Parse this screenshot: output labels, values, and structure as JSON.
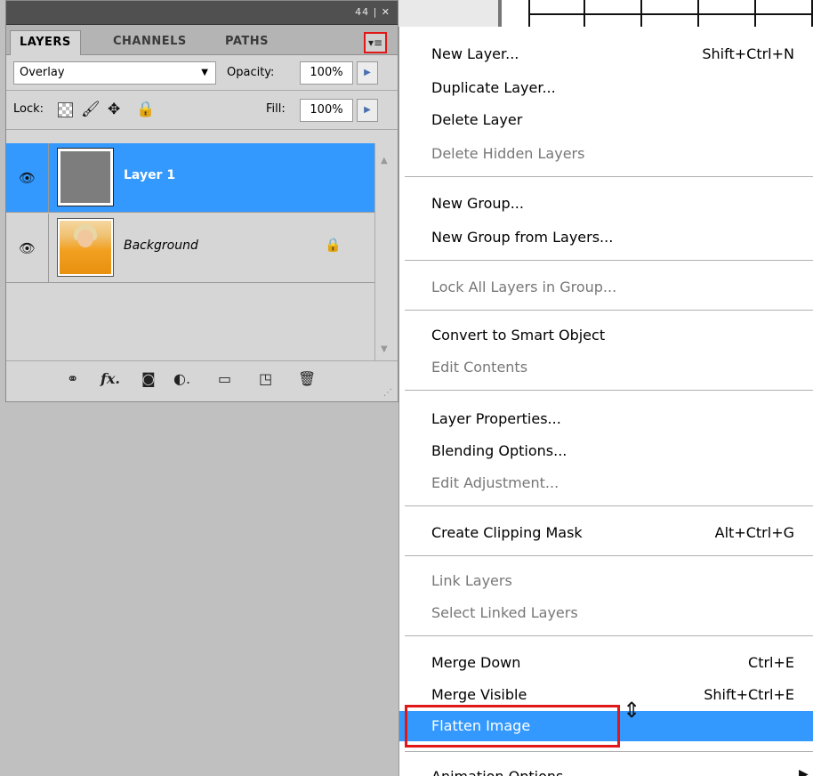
{
  "panel": {
    "titlebar_controls": "44 | ✕",
    "tabs": [
      "LAYERS",
      "CHANNELS",
      "PATHS"
    ],
    "menu_button_icon": "panel-menu-icon",
    "blend_mode": "Overlay",
    "opacity_label": "Opacity:",
    "opacity_value": "100%",
    "lock_label": "Lock:",
    "fill_label": "Fill:",
    "fill_value": "100%",
    "layers": [
      {
        "name": "Layer 1",
        "selected": true
      },
      {
        "name": "Background",
        "selected": false,
        "locked": true
      }
    ],
    "footer_icons": [
      "link-icon",
      "fx-icon",
      "mask-icon",
      "adjustment-icon",
      "folder-icon",
      "new-layer-icon",
      "trash-icon"
    ]
  },
  "menu": {
    "items": [
      {
        "label": "New Layer...",
        "shortcut": "Shift+Ctrl+N",
        "enabled": true
      },
      {
        "label": "Duplicate Layer...",
        "shortcut": "",
        "enabled": true
      },
      {
        "label": "Delete Layer",
        "shortcut": "",
        "enabled": true
      },
      {
        "label": "Delete Hidden Layers",
        "shortcut": "",
        "enabled": false
      },
      {
        "label": "New Group...",
        "shortcut": "",
        "enabled": true
      },
      {
        "label": "New Group from Layers...",
        "shortcut": "",
        "enabled": true
      },
      {
        "label": "Lock All Layers in Group...",
        "shortcut": "",
        "enabled": false
      },
      {
        "label": "Convert to Smart Object",
        "shortcut": "",
        "enabled": true
      },
      {
        "label": "Edit Contents",
        "shortcut": "",
        "enabled": false
      },
      {
        "label": "Layer Properties...",
        "shortcut": "",
        "enabled": true
      },
      {
        "label": "Blending Options...",
        "shortcut": "",
        "enabled": true
      },
      {
        "label": "Edit Adjustment...",
        "shortcut": "",
        "enabled": false
      },
      {
        "label": "Create Clipping Mask",
        "shortcut": "Alt+Ctrl+G",
        "enabled": true
      },
      {
        "label": "Link Layers",
        "shortcut": "",
        "enabled": false
      },
      {
        "label": "Select Linked Layers",
        "shortcut": "",
        "enabled": false
      },
      {
        "label": "Merge Down",
        "shortcut": "Ctrl+E",
        "enabled": true
      },
      {
        "label": "Merge Visible",
        "shortcut": "Shift+Ctrl+E",
        "enabled": true
      },
      {
        "label": "Flatten Image",
        "shortcut": "",
        "enabled": true,
        "highlighted": true
      },
      {
        "label": "Animation Options",
        "shortcut": "",
        "enabled": true
      }
    ]
  },
  "colors": {
    "selection": "#3399ff",
    "annotation_red": "#e01818",
    "panel_bg": "#d6d6d6"
  }
}
